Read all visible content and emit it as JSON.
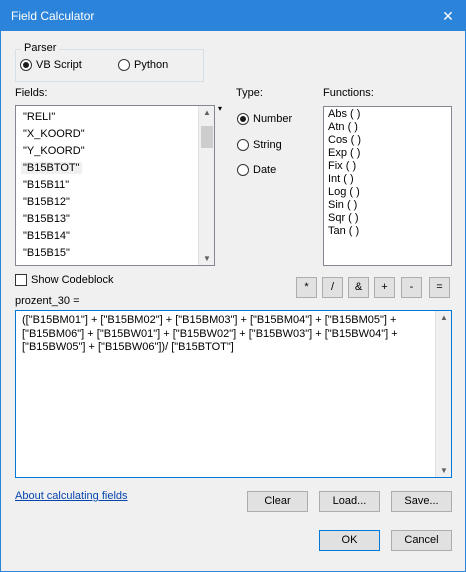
{
  "window": {
    "title": "Field Calculator",
    "close_glyph": "✕"
  },
  "parser": {
    "label": "Parser",
    "options": [
      {
        "label": "VB Script",
        "checked": true
      },
      {
        "label": "Python",
        "checked": false
      }
    ]
  },
  "fields": {
    "label": "Fields:",
    "items": [
      "\"RELI\"",
      "\"X_KOORD\"",
      "\"Y_KOORD\"",
      "\"B15BTOT\"",
      "\"B15B11\"",
      "\"B15B12\"",
      "\"B15B13\"",
      "\"B15B14\"",
      "\"B15B15\""
    ],
    "selected_index": 3
  },
  "type": {
    "label": "Type:",
    "options": [
      {
        "label": "Number",
        "checked": true
      },
      {
        "label": "String",
        "checked": false
      },
      {
        "label": "Date",
        "checked": false
      }
    ]
  },
  "functions": {
    "label": "Functions:",
    "items": [
      "Abs ( )",
      "Atn ( )",
      "Cos ( )",
      "Exp ( )",
      "Fix ( )",
      "Int ( )",
      "Log ( )",
      "Sin ( )",
      "Sqr ( )",
      "Tan ( )"
    ]
  },
  "codeblock": {
    "label": "Show Codeblock",
    "checked": false
  },
  "operators": [
    "*",
    "/",
    "&",
    "+",
    "-",
    "="
  ],
  "expression": {
    "target_label": "prozent_30 =",
    "text": "([\"B15BM01\"] + [\"B15BM02\"] + [\"B15BM03\"] + [\"B15BM04\"] + [\"B15BM05\"] +\n[\"B15BM06\"] + [\"B15BW01\"] + [\"B15BW02\"] + [\"B15BW03\"] + [\"B15BW04\"] +\n[\"B15BW05\"] + [\"B15BW06\"])/ [\"B15BTOT\"]"
  },
  "actions": {
    "help_link": "About calculating fields",
    "clear": "Clear",
    "load": "Load...",
    "save": "Save...",
    "ok": "OK",
    "cancel": "Cancel"
  }
}
